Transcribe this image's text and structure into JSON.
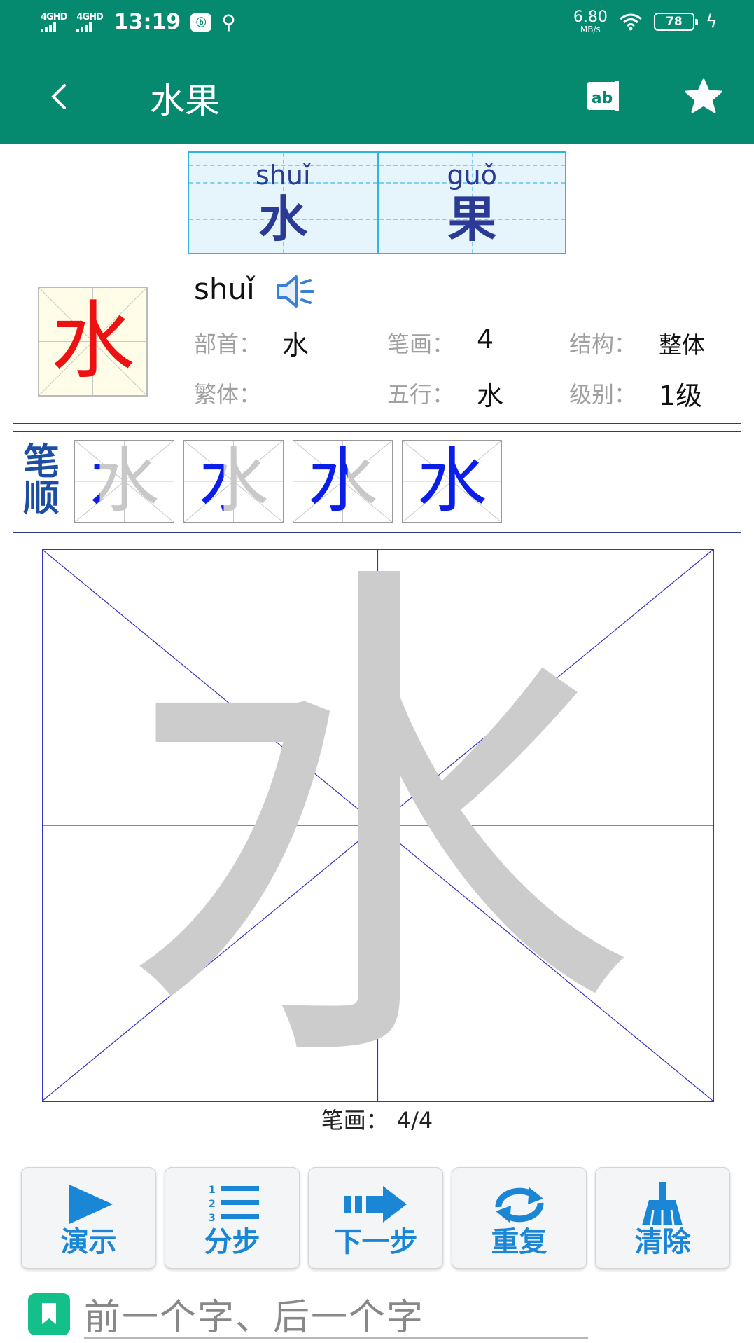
{
  "status_bar": {
    "net1": "4GHD",
    "net2": "4GHD",
    "time": "13:19",
    "app_badge": "ⓑ",
    "speed_value": "6.80",
    "speed_unit": "MB/s",
    "battery": "78"
  },
  "appbar": {
    "title": "水果"
  },
  "word": [
    {
      "pinyin": "shuǐ",
      "char": "水"
    },
    {
      "pinyin": "guǒ",
      "char": "果"
    }
  ],
  "info": {
    "char": "水",
    "pinyin": "shuǐ",
    "radical_label": "部首：",
    "radical_value": "水",
    "strokes_label": "笔画：",
    "strokes_value": "4",
    "structure_label": "结构：",
    "structure_value": "整体",
    "traditional_label": "繁体：",
    "traditional_value": "",
    "wuxing_label": "五行：",
    "wuxing_value": "水",
    "level_label": "级别：",
    "level_value": "1级"
  },
  "stroke_order": {
    "title_line1": "笔",
    "title_line2": "顺",
    "char": "水",
    "steps": 4
  },
  "practice": {
    "char": "水",
    "count_label": "笔画：",
    "count_value": "4/4"
  },
  "buttons": {
    "demo": "演示",
    "step": "分步",
    "next": "下一步",
    "repeat": "重复",
    "clear": "清除"
  },
  "bottom": {
    "nav_text": "前一个字、后一个字"
  },
  "colors": {
    "primary": "#05896f",
    "button_text": "#1a86d6",
    "char_red": "#ee1111",
    "stroke_blue": "#0a1ee8",
    "word_blue": "#2a3a95"
  }
}
